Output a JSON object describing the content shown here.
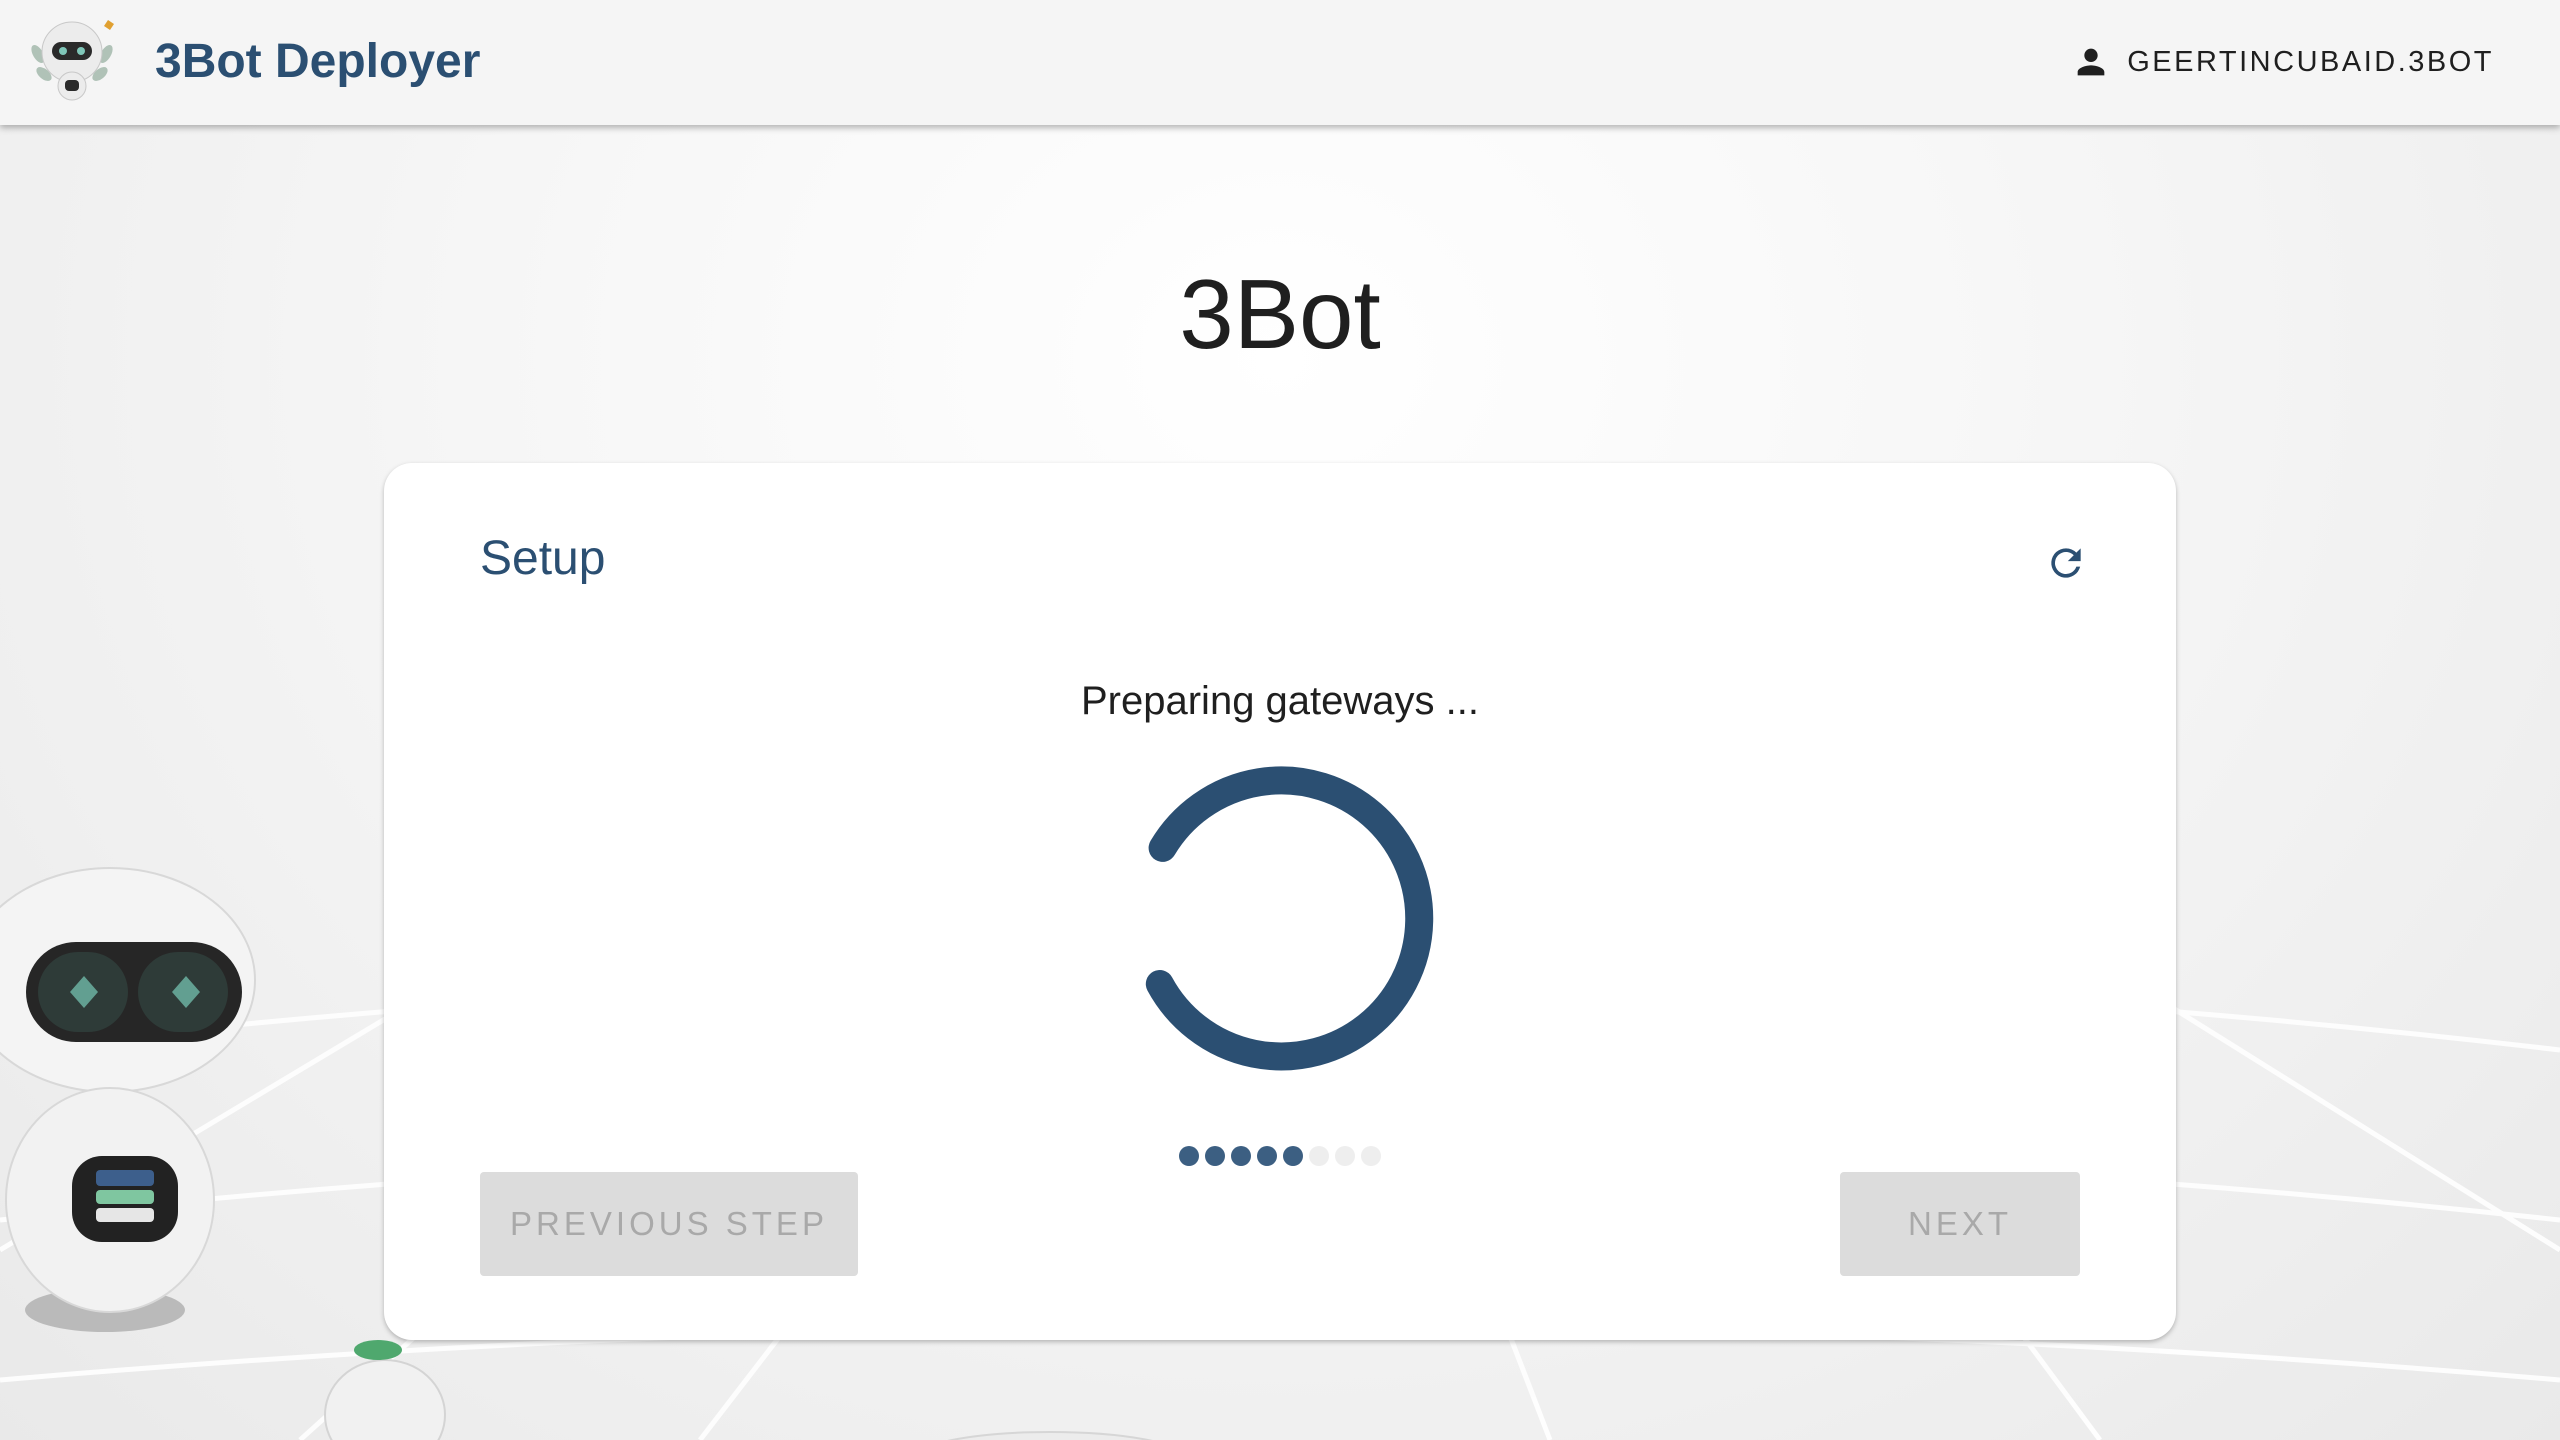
{
  "header": {
    "app_title": "3Bot Deployer",
    "user_name": "GEERTINCUBAID.3BOT"
  },
  "page": {
    "title": "3Bot"
  },
  "card": {
    "title": "Setup",
    "status_text": "Preparing gateways ...",
    "steps_total": 8,
    "steps_completed": 5,
    "previous_label": "PREVIOUS STEP",
    "next_label": "NEXT"
  },
  "icons": {
    "user": "person-icon",
    "refresh": "refresh-icon",
    "logo": "3bot-robot-logo"
  },
  "colors": {
    "brand": "#2b4f72",
    "spinner": "#2b4f72",
    "button_disabled_bg": "#dcdcdc",
    "button_disabled_text": "#a9a9a9"
  }
}
